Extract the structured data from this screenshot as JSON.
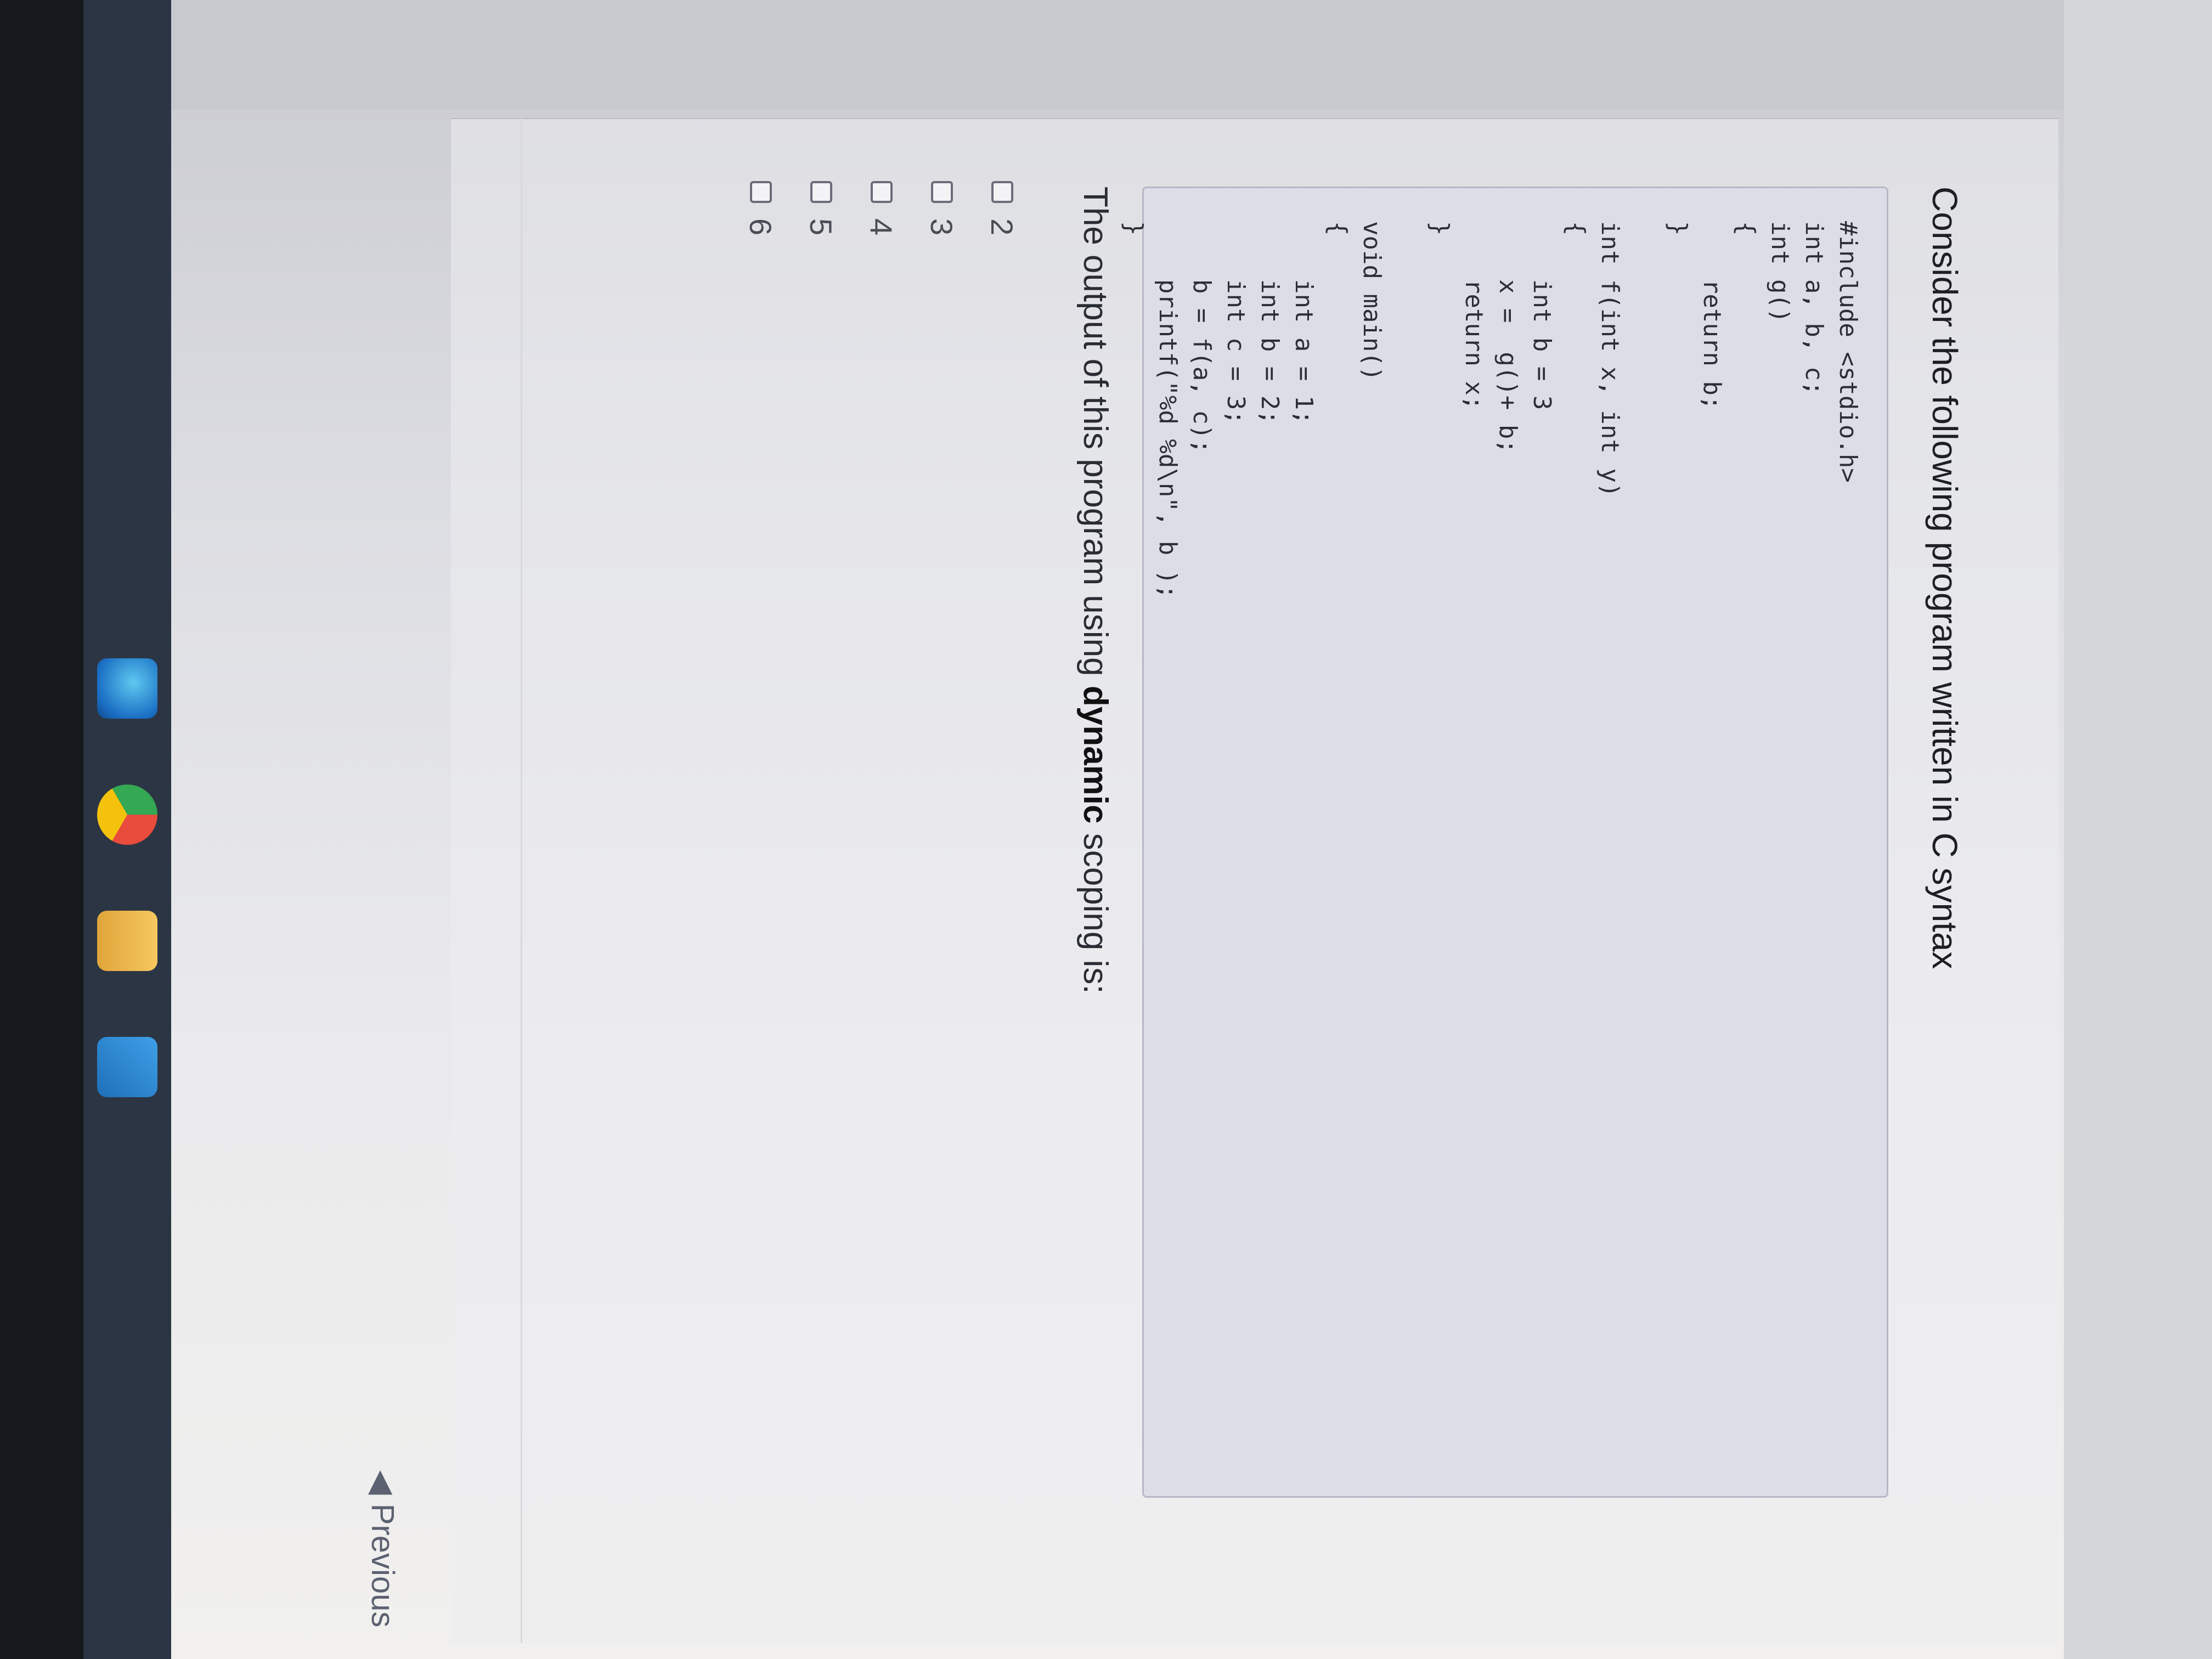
{
  "question": {
    "title": "Consider the following program written in C syntax",
    "code": "#include <stdio.h>\nint a, b, c;\nint g()\n{\n    return b;\n}\n\nint f(int x, int y)\n{\n    int b = 3\n    x =  g()+ b;\n    return x;\n}\n\nvoid main()\n{\n    int a = 1;\n    int b = 2;\n    int c = 3;\n    b = f(a, c);\n    printf(\"%d %d\\n\", b );\n}",
    "prompt_before": "The output of this program using ",
    "prompt_emphasis": "dynamic",
    "prompt_after": " scoping is:"
  },
  "options": [
    "2",
    "3",
    "4",
    "5",
    "6"
  ],
  "navigation": {
    "previous_label": "Previous",
    "previous_icon": "chevron-left-icon"
  },
  "colors": {
    "code_background": "#dcdde6",
    "taskbar": "#2c3544",
    "page_background": "#e9e9ec"
  },
  "taskbar_icons": [
    "edge-icon",
    "chrome-icon",
    "file-explorer-icon",
    "mail-icon"
  ]
}
